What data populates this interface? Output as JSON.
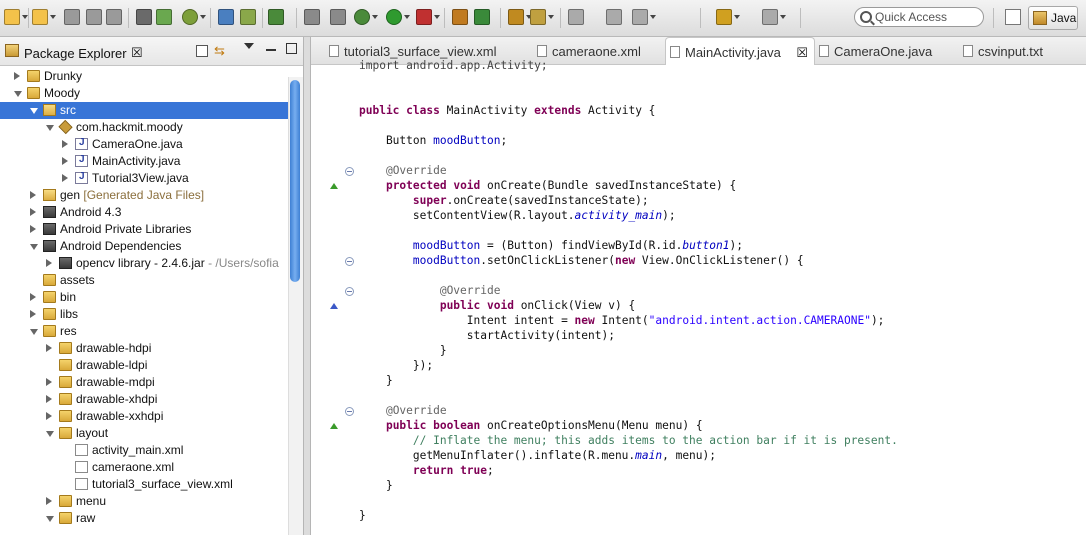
{
  "toolbar": {
    "icons": [
      "new-icon",
      "new-wizard-icon",
      "save-icon",
      "save-all-icon",
      "print-icon",
      "binary-icon",
      "sdk-manager-icon",
      "android-icon",
      "download-icon",
      "device-icon",
      "checkbox-icon",
      "tasks-icon",
      "skip-breakpoints-icon",
      "debug-icon",
      "run-icon",
      "external-tools-icon",
      "new-java-project-icon",
      "new-class-icon",
      "open-type-icon",
      "search-icon",
      "annotation-icon",
      "prev-annotation-icon",
      "next-annotation-icon",
      "back-icon",
      "forward-icon"
    ],
    "quick_access_placeholder": "Quick Access",
    "perspective_label": "Java"
  },
  "explorer": {
    "title": "Package Explorer",
    "tree": [
      {
        "label": "Drunky",
        "indent": 0,
        "state": "closed",
        "icon": "project"
      },
      {
        "label": "Moody",
        "indent": 0,
        "state": "open",
        "icon": "project"
      },
      {
        "label": "src",
        "indent": 1,
        "state": "open",
        "icon": "srcfolder",
        "selected": true
      },
      {
        "label": "com.hackmit.moody",
        "indent": 2,
        "state": "open",
        "icon": "package"
      },
      {
        "label": "CameraOne.java",
        "indent": 3,
        "state": "closed",
        "icon": "java"
      },
      {
        "label": "MainActivity.java",
        "indent": 3,
        "state": "closed",
        "icon": "java"
      },
      {
        "label": "Tutorial3View.java",
        "indent": 3,
        "state": "closed",
        "icon": "java"
      },
      {
        "label": "gen",
        "suffix": " [Generated Java Files]",
        "indent": 1,
        "state": "closed",
        "icon": "srcfolder"
      },
      {
        "label": "Android 4.3",
        "indent": 1,
        "state": "closed",
        "icon": "lib"
      },
      {
        "label": "Android Private Libraries",
        "indent": 1,
        "state": "closed",
        "icon": "lib"
      },
      {
        "label": "Android Dependencies",
        "indent": 1,
        "state": "open",
        "icon": "lib"
      },
      {
        "label": "opencv library - 2.4.6.jar",
        "suffix": " - /Users/sofia",
        "indent": 2,
        "state": "closed",
        "icon": "jar"
      },
      {
        "label": "assets",
        "indent": 1,
        "state": "none",
        "icon": "folder"
      },
      {
        "label": "bin",
        "indent": 1,
        "state": "closed",
        "icon": "folder"
      },
      {
        "label": "libs",
        "indent": 1,
        "state": "closed",
        "icon": "folder"
      },
      {
        "label": "res",
        "indent": 1,
        "state": "open",
        "icon": "folder"
      },
      {
        "label": "drawable-hdpi",
        "indent": 2,
        "state": "closed",
        "icon": "folder"
      },
      {
        "label": "drawable-ldpi",
        "indent": 2,
        "state": "none",
        "icon": "folder"
      },
      {
        "label": "drawable-mdpi",
        "indent": 2,
        "state": "closed",
        "icon": "folder"
      },
      {
        "label": "drawable-xhdpi",
        "indent": 2,
        "state": "closed",
        "icon": "folder"
      },
      {
        "label": "drawable-xxhdpi",
        "indent": 2,
        "state": "closed",
        "icon": "folder"
      },
      {
        "label": "layout",
        "indent": 2,
        "state": "open",
        "icon": "folder"
      },
      {
        "label": "activity_main.xml",
        "indent": 3,
        "state": "none",
        "icon": "xml"
      },
      {
        "label": "cameraone.xml",
        "indent": 3,
        "state": "none",
        "icon": "xml"
      },
      {
        "label": "tutorial3_surface_view.xml",
        "indent": 3,
        "state": "none",
        "icon": "xml"
      },
      {
        "label": "menu",
        "indent": 2,
        "state": "closed",
        "icon": "folder"
      },
      {
        "label": "raw",
        "indent": 2,
        "state": "open",
        "icon": "folder"
      }
    ]
  },
  "editor": {
    "tabs": [
      {
        "label": "tutorial3_surface_view.xml",
        "icon": "xml-file-icon",
        "active": false
      },
      {
        "label": "cameraone.xml",
        "icon": "xml-file-icon",
        "active": false
      },
      {
        "label": "MainActivity.java",
        "icon": "java-file-icon",
        "active": true
      },
      {
        "label": "CameraOne.java",
        "icon": "java-file-icon",
        "active": false
      },
      {
        "label": "csvinput.txt",
        "icon": "text-file-icon",
        "active": false
      }
    ],
    "code": [
      [
        {
          "t": "import android.app.Activity;",
          "c": "cut"
        }
      ],
      [],
      [],
      [
        {
          "t": "public",
          "c": "kw"
        },
        {
          "t": " "
        },
        {
          "t": "class",
          "c": "kw"
        },
        {
          "t": " MainActivity "
        },
        {
          "t": "extends",
          "c": "kw"
        },
        {
          "t": " Activity {"
        }
      ],
      [],
      [
        {
          "t": "    Button "
        },
        {
          "t": "moodButton",
          "c": "fd"
        },
        {
          "t": ";"
        }
      ],
      [],
      [
        {
          "t": "    "
        },
        {
          "t": "@Override",
          "c": "an"
        }
      ],
      [
        {
          "t": "    "
        },
        {
          "t": "protected",
          "c": "kw"
        },
        {
          "t": " "
        },
        {
          "t": "void",
          "c": "kw"
        },
        {
          "t": " onCreate(Bundle savedInstanceState) {"
        }
      ],
      [
        {
          "t": "        "
        },
        {
          "t": "super",
          "c": "kw"
        },
        {
          "t": ".onCreate(savedInstanceState);"
        }
      ],
      [
        {
          "t": "        setContentView(R.layout."
        },
        {
          "t": "activity_main",
          "c": "it"
        },
        {
          "t": ");"
        }
      ],
      [],
      [
        {
          "t": "        "
        },
        {
          "t": "moodButton",
          "c": "fd"
        },
        {
          "t": " = (Button) findViewById(R.id."
        },
        {
          "t": "button1",
          "c": "it"
        },
        {
          "t": ");"
        }
      ],
      [
        {
          "t": "        "
        },
        {
          "t": "moodButton",
          "c": "fd"
        },
        {
          "t": ".setOnClickListener("
        },
        {
          "t": "new",
          "c": "kw"
        },
        {
          "t": " View.OnClickListener() {"
        }
      ],
      [],
      [
        {
          "t": "            "
        },
        {
          "t": "@Override",
          "c": "an"
        }
      ],
      [
        {
          "t": "            "
        },
        {
          "t": "public",
          "c": "kw"
        },
        {
          "t": " "
        },
        {
          "t": "void",
          "c": "kw"
        },
        {
          "t": " onClick(View v) {"
        }
      ],
      [
        {
          "t": "                Intent intent = "
        },
        {
          "t": "new",
          "c": "kw"
        },
        {
          "t": " Intent("
        },
        {
          "t": "\"android.intent.action.CAMERAONE\"",
          "c": "st"
        },
        {
          "t": ");"
        }
      ],
      [
        {
          "t": "                startActivity(intent);"
        }
      ],
      [
        {
          "t": "            }"
        }
      ],
      [
        {
          "t": "        });"
        }
      ],
      [
        {
          "t": "    }"
        }
      ],
      [],
      [
        {
          "t": "    "
        },
        {
          "t": "@Override",
          "c": "an"
        }
      ],
      [
        {
          "t": "    "
        },
        {
          "t": "public",
          "c": "kw"
        },
        {
          "t": " "
        },
        {
          "t": "boolean",
          "c": "kw"
        },
        {
          "t": " onCreateOptionsMenu(Menu menu) {"
        }
      ],
      [
        {
          "t": "        "
        },
        {
          "t": "// Inflate the menu; this adds items to the action bar if it is present.",
          "c": "cm"
        }
      ],
      [
        {
          "t": "        getMenuInflater().inflate(R.menu."
        },
        {
          "t": "main",
          "c": "it"
        },
        {
          "t": ", menu);"
        }
      ],
      [
        {
          "t": "        "
        },
        {
          "t": "return",
          "c": "kw"
        },
        {
          "t": " "
        },
        {
          "t": "true",
          "c": "kw"
        },
        {
          "t": ";"
        }
      ],
      [
        {
          "t": "    }"
        }
      ],
      [],
      [
        {
          "t": "}"
        }
      ]
    ]
  }
}
